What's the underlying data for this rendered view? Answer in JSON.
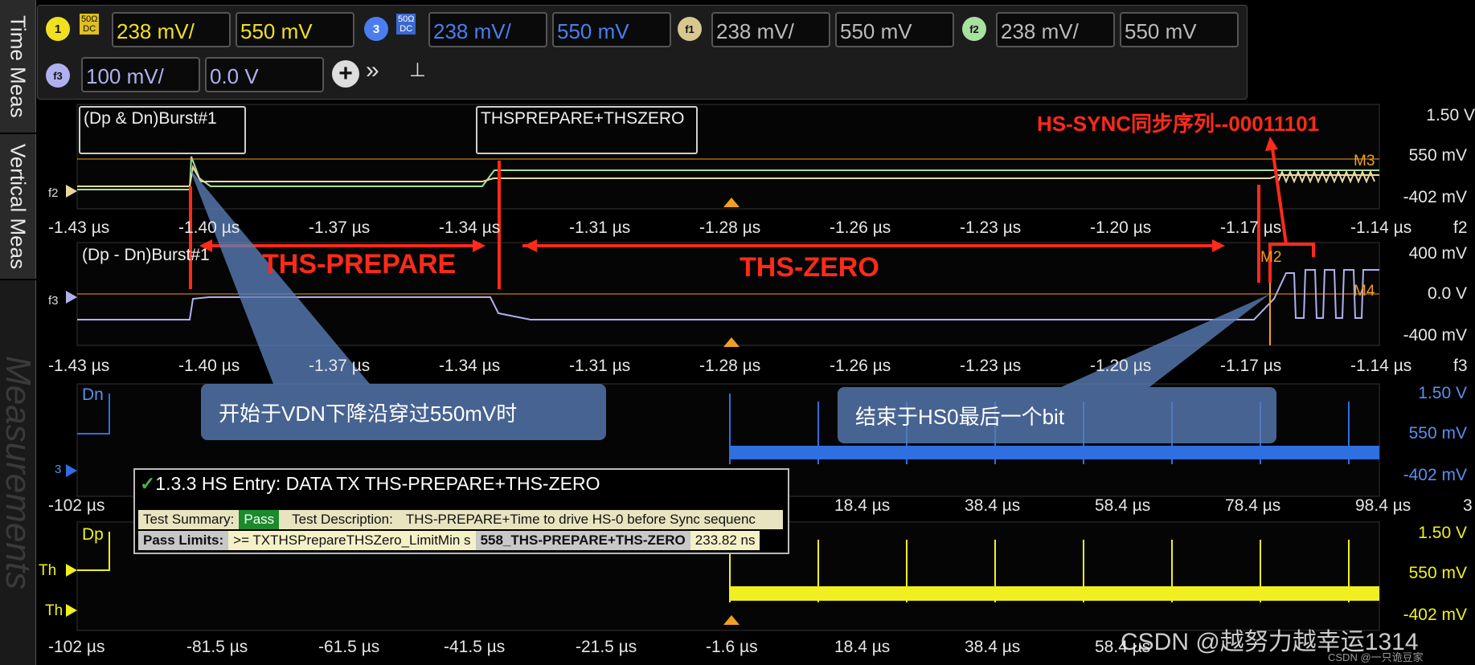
{
  "sidebar": {
    "tabs": [
      {
        "label": "Time Meas"
      },
      {
        "label": "Vertical Meas"
      },
      {
        "label": "Measurements"
      }
    ]
  },
  "toolbar": {
    "channels": [
      {
        "badge": "1",
        "term_top": "50Ω",
        "term_bottom": "DC",
        "scale": "238 mV/",
        "offset": "550 mV",
        "color": "#f0e020"
      },
      {
        "badge": "3",
        "term_top": "50Ω",
        "term_bottom": "DC",
        "scale": "238 mV/",
        "offset": "550 mV",
        "color": "#4a7ef0"
      },
      {
        "badge": "f1",
        "scale": "238 mV/",
        "offset": "550 mV",
        "color": "#d8c890"
      },
      {
        "badge": "f2",
        "scale": "238 mV/",
        "offset": "550 mV",
        "color": "#a8e0a0"
      },
      {
        "badge": "f3",
        "scale": "100 mV/",
        "offset": "0.0 V",
        "color": "#b0b0f0"
      }
    ],
    "add_icon": "plus-circle-icon",
    "more_icon": "double-chevron-icon",
    "pin_icon": "pin-icon"
  },
  "panes": {
    "f2": {
      "box_label": "(Dp & Dn)Burst#1",
      "region_label": "THSPREPARE+THSZERO",
      "annotation": "HS-SYNC同步序列--00011101",
      "marker_label": "M3",
      "ch_label": "f2",
      "v_labels": [
        "1.50 V",
        "550 mV",
        "-402 mV"
      ],
      "t_labels": [
        "-1.43 µs",
        "-1.40 µs",
        "-1.37 µs",
        "-1.34 µs",
        "-1.31 µs",
        "-1.28 µs",
        "-1.26 µs",
        "-1.23 µs",
        "-1.20 µs",
        "-1.17 µs",
        "-1.14 µs"
      ],
      "right_ch": "f2"
    },
    "f3": {
      "box_label": "(Dp - Dn)Burst#1",
      "prepare_label": "THS-PREPARE",
      "zero_label": "THS-ZERO",
      "marker_m2": "M2",
      "marker_m4": "M4",
      "ch_label": "f3",
      "v_labels": [
        "400 mV",
        "0.0 V",
        "-400 mV"
      ],
      "t_labels": [
        "-1.43 µs",
        "-1.40 µs",
        "-1.37 µs",
        "-1.34 µs",
        "-1.31 µs",
        "-1.28 µs",
        "-1.26 µs",
        "-1.23 µs",
        "-1.20 µs",
        "-1.17 µs",
        "-1.14 µs"
      ],
      "right_ch": "f3"
    },
    "dn": {
      "label": "Dn",
      "ch_label": "3",
      "v_labels": [
        "1.50 V",
        "550 mV",
        "-402 mV"
      ],
      "t_labels": [
        "-102 µs",
        "18.4 µs",
        "38.4 µs",
        "58.4 µs",
        "78.4 µs",
        "98.4 µs"
      ],
      "right_ch": "3"
    },
    "dp": {
      "label": "Dp",
      "th_upper": "Th",
      "th_lower": "Th",
      "v_labels": [
        "1.50 V",
        "550 mV",
        "-402 mV"
      ],
      "t_labels": [
        "-102 µs",
        "-81.5 µs",
        "-61.5 µs",
        "-41.5 µs",
        "-21.5 µs",
        "-1.6 µs",
        "18.4 µs",
        "38.4 µs",
        "58.4 µs"
      ]
    }
  },
  "callouts": {
    "left": "开始于VDN下降沿穿过550mV时",
    "right": "结束于HS0最后一个bit"
  },
  "test_panel": {
    "title": "1.3.3 HS Entry: DATA TX THS-PREPARE+THS-ZERO",
    "summary_label": "Test Summary:",
    "summary_value": "Pass",
    "desc_label": "Test Description:",
    "desc_value": "THS-PREPARE+Time to drive HS-0 before Sync sequenc",
    "limits_label": "Pass Limits:",
    "limits_value": ">= TXTHSPrepareTHSZero_LimitMin s",
    "meas_name": "558_THS-PREPARE+THS-ZERO",
    "meas_value": "233.82 ns"
  },
  "watermark": {
    "main": "CSDN @越努力越幸运1314",
    "small": "CSDN @一只诡豆家"
  },
  "colors": {
    "red": "#ff2a1a",
    "yellow": "#f0e020",
    "blue": "#2f6fe0",
    "lavender": "#b0b0f0",
    "green": "#a8e0a0",
    "tan": "#e8d8a0",
    "orange": "#f0a020"
  }
}
